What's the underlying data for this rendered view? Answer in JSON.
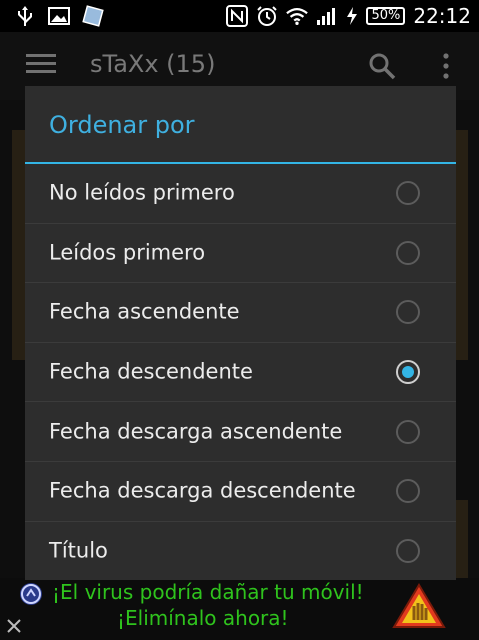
{
  "status_bar": {
    "battery": "50%",
    "time": "22:12"
  },
  "action_bar": {
    "title": "sTaXx (15)",
    "icons": [
      "menu-icon",
      "search-icon",
      "overflow-menu-icon"
    ]
  },
  "dialog": {
    "title": "Ordenar por",
    "options": [
      {
        "label": "No leídos primero",
        "checked": false
      },
      {
        "label": "Leídos primero",
        "checked": false
      },
      {
        "label": "Fecha ascendente",
        "checked": false
      },
      {
        "label": "Fecha descendente",
        "checked": true
      },
      {
        "label": "Fecha descarga ascendente",
        "checked": false
      },
      {
        "label": "Fecha descarga descendente",
        "checked": false
      },
      {
        "label": "Título",
        "checked": false
      }
    ]
  },
  "ad": {
    "line1": "¡El virus podría dañar tu móvil!",
    "line2": "¡Elimínalo ahora!"
  },
  "colors": {
    "accent": "#33b5e5",
    "ad_text": "#2fc31d"
  }
}
